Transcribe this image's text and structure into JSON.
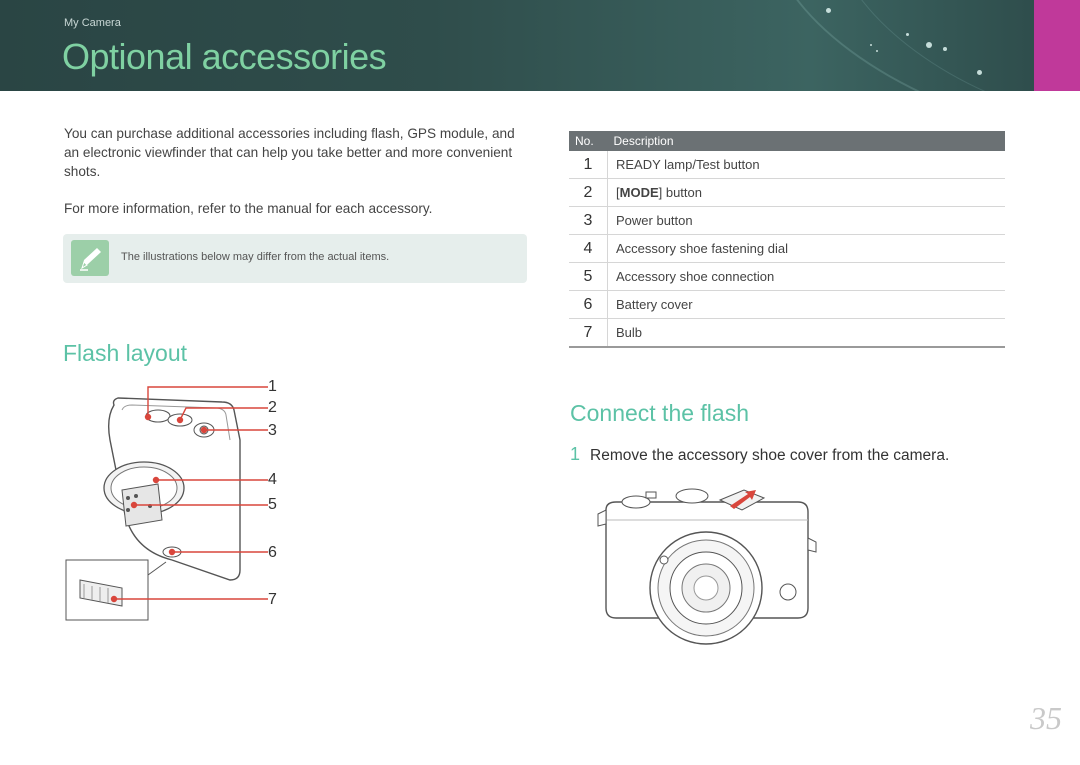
{
  "header": {
    "breadcrumb": "My Camera",
    "title": "Optional accessories",
    "accent_color": "#c0399a",
    "title_color": "#7fd1a2"
  },
  "intro": {
    "paragraph1": "You can purchase additional accessories including flash, GPS module, and an electronic viewfinder that can help you take better and more convenient shots.",
    "paragraph2": "For more information, refer to the manual for each accessory."
  },
  "note": {
    "icon": "pencil-note-icon",
    "text": "The illustrations below may differ from the actual items."
  },
  "flash_layout": {
    "heading": "Flash layout",
    "callouts": [
      "1",
      "2",
      "3",
      "4",
      "5",
      "6",
      "7"
    ]
  },
  "table": {
    "headers": {
      "no": "No.",
      "description": "Description"
    },
    "rows": [
      {
        "no": "1",
        "description": "READY lamp/Test button"
      },
      {
        "no": "2",
        "description_prefix": "[",
        "description_bold": "MODE",
        "description_suffix": "] button"
      },
      {
        "no": "3",
        "description": "Power button"
      },
      {
        "no": "4",
        "description": "Accessory shoe fastening dial"
      },
      {
        "no": "5",
        "description": "Accessory shoe connection"
      },
      {
        "no": "6",
        "description": "Battery cover"
      },
      {
        "no": "7",
        "description": "Bulb"
      }
    ]
  },
  "connect": {
    "heading": "Connect the flash",
    "step_number": "1",
    "step_text": "Remove the accessory shoe cover from the camera."
  },
  "page_number": "35"
}
